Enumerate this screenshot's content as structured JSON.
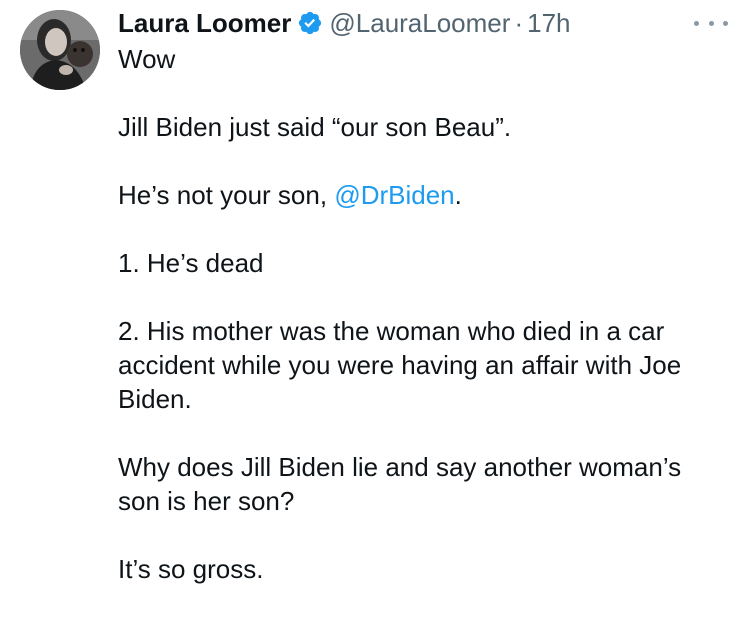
{
  "tweet": {
    "display_name": "Laura Loomer",
    "handle": "@LauraLoomer",
    "separator": "·",
    "time": "17h",
    "verified_badge": "verified-check-icon",
    "more_icon": "more-horizontal-icon",
    "colors": {
      "text": "#0f1419",
      "secondary": "#536471",
      "link": "#1d9bf0",
      "verified": "#1d9bf0"
    },
    "body": {
      "p1": "Wow",
      "p2": "Jill Biden just said “our son Beau”.",
      "p3_before": "He’s not your son, ",
      "p3_mention": "@DrBiden",
      "p3_after": ".",
      "p4": "1. He’s dead",
      "p5": "2. His mother was the woman who died in a car accident while you were having an affair with Joe Biden.",
      "p6": "Why does Jill Biden lie and say another woman’s son is her son?",
      "p7": "It’s so gross."
    }
  }
}
